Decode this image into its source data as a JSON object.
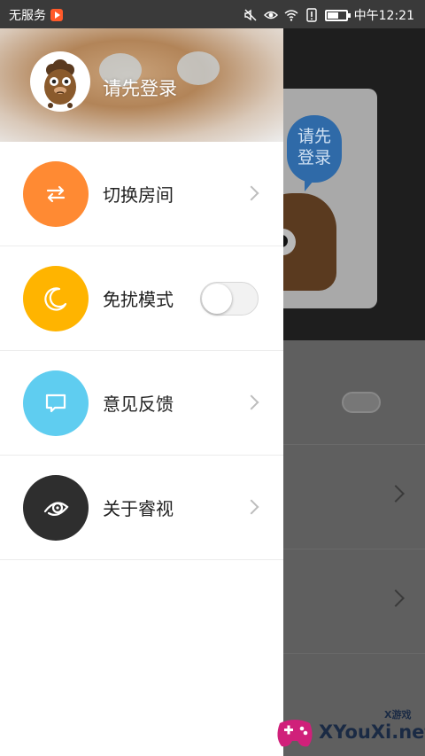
{
  "status_bar": {
    "carrier": "无服务",
    "time": "中午12:21",
    "icons": [
      "play-badge-icon",
      "mute-icon",
      "eye-icon",
      "wifi-icon",
      "alert-icon",
      "battery-icon"
    ]
  },
  "drawer": {
    "header": {
      "login_prompt": "请先登录",
      "avatar_icon": "monkey-avatar-icon"
    },
    "items": [
      {
        "label": "切换房间",
        "icon": "switch-arrows-icon",
        "color": "#ff8a33",
        "accessory": "chevron"
      },
      {
        "label": "免扰模式",
        "icon": "moon-icon",
        "color": "#ffb400",
        "accessory": "toggle",
        "toggle_on": false
      },
      {
        "label": "意见反馈",
        "icon": "message-icon",
        "color": "#5fcdf0",
        "accessory": "chevron"
      },
      {
        "label": "关于睿视",
        "icon": "eye-logo-icon",
        "color": "#2e2e2e",
        "accessory": "chevron"
      }
    ]
  },
  "background_app": {
    "bubble_text": "请先\n登录"
  },
  "watermark": {
    "text": "XYouXi.net",
    "small_text": "X游戏"
  }
}
